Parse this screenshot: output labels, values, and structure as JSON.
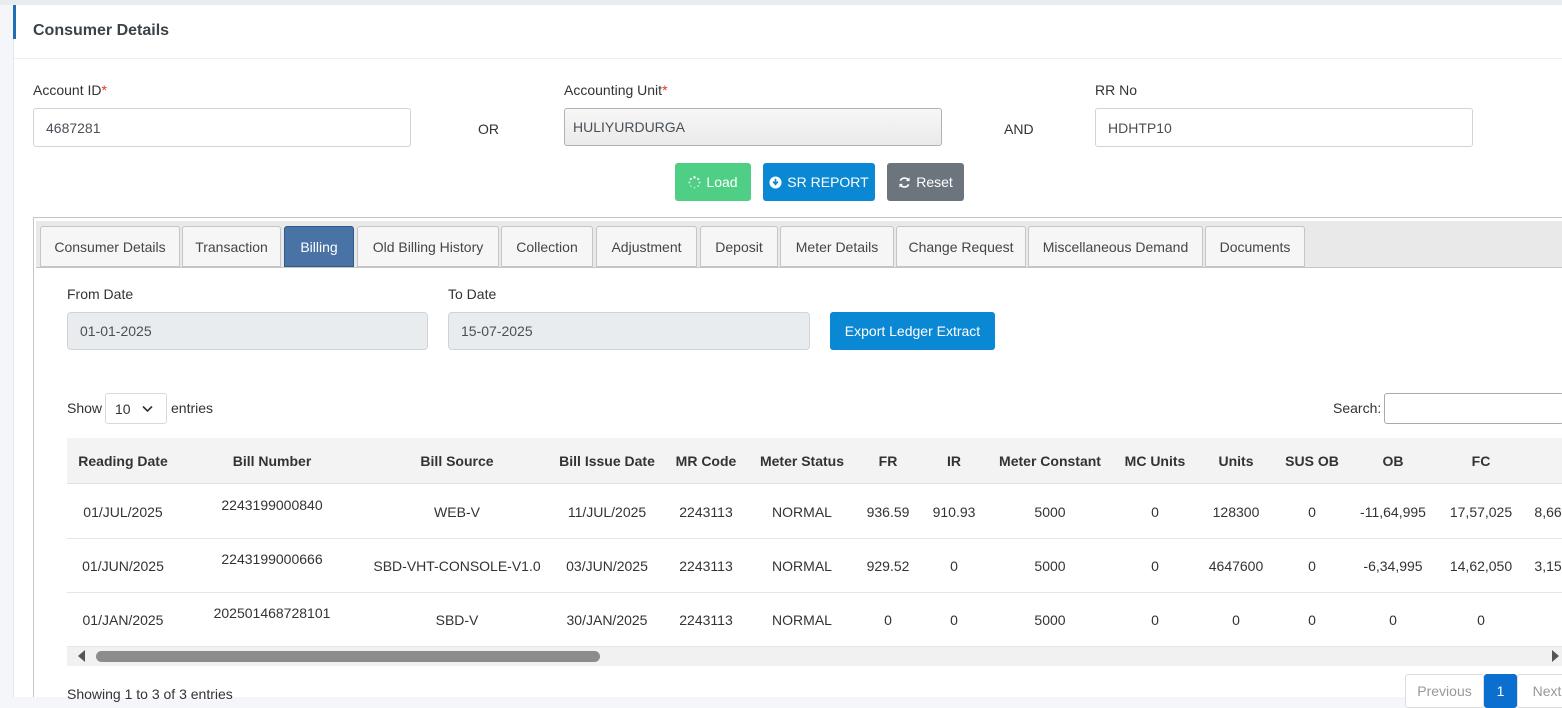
{
  "card": {
    "title": "Consumer Details"
  },
  "form": {
    "account_id_label": "Account ID",
    "account_id_value": "4687281",
    "or_label": "OR",
    "accounting_unit_label": "Accounting Unit",
    "accounting_unit_value": "HULIYURDURGA",
    "and_label": "AND",
    "rr_no_label": "RR No",
    "rr_no_value": "HDHTP10",
    "required_mark": "*"
  },
  "actions": {
    "load": "Load",
    "sr_report": "SR REPORT",
    "reset": "Reset"
  },
  "tabs": [
    "Consumer Details",
    "Transaction",
    "Billing",
    "Old Billing History",
    "Collection",
    "Adjustment",
    "Deposit",
    "Meter Details",
    "Change Request",
    "Miscellaneous Demand",
    "Documents"
  ],
  "active_tab": "Billing",
  "billing": {
    "from_label": "From Date",
    "from_value": "01-01-2025",
    "to_label": "To Date",
    "to_value": "15-07-2025",
    "export_label": "Export Ledger Extract"
  },
  "table": {
    "show_label": "Show",
    "entries_label": "entries",
    "page_length": "10",
    "search_label": "Search:",
    "columns": [
      "Reading Date",
      "Bill Number",
      "Bill Source",
      "Bill Issue Date",
      "MR Code",
      "Meter Status",
      "FR",
      "IR",
      "Meter Constant",
      "MC Units",
      "Units",
      "SUS OB",
      "OB",
      "FC",
      ""
    ],
    "rows": [
      [
        "01/JUL/2025",
        "2243199000840",
        "WEB-V",
        "11/JUL/2025",
        "2243113",
        "NORMAL",
        "936.59",
        "910.93",
        "5000",
        "0",
        "128300",
        "0",
        "-11,64,995",
        "17,57,025",
        "8,66,"
      ],
      [
        "01/JUN/2025",
        "2243199000666",
        "SBD-VHT-CONSOLE-V1.0",
        "03/JUN/2025",
        "2243113",
        "NORMAL",
        "929.52",
        "0",
        "5000",
        "0",
        "4647600",
        "0",
        "-6,34,995",
        "14,62,050",
        "3,15,"
      ],
      [
        "01/JAN/2025",
        "202501468728101",
        "SBD-V",
        "30/JAN/2025",
        "2243113",
        "NORMAL",
        "0",
        "0",
        "5000",
        "0",
        "0",
        "0",
        "0",
        "0",
        ""
      ]
    ],
    "info": "Showing 1 to 3 of 3 entries",
    "pagination": {
      "previous": "Previous",
      "current": "1",
      "next": "Next"
    }
  },
  "colors": {
    "accent": "#1f6fb2",
    "load_button": "#4fcf86",
    "primary_button": "#0b88d4",
    "reset_button": "#6c757d",
    "active_tab": "#4a73a5"
  }
}
